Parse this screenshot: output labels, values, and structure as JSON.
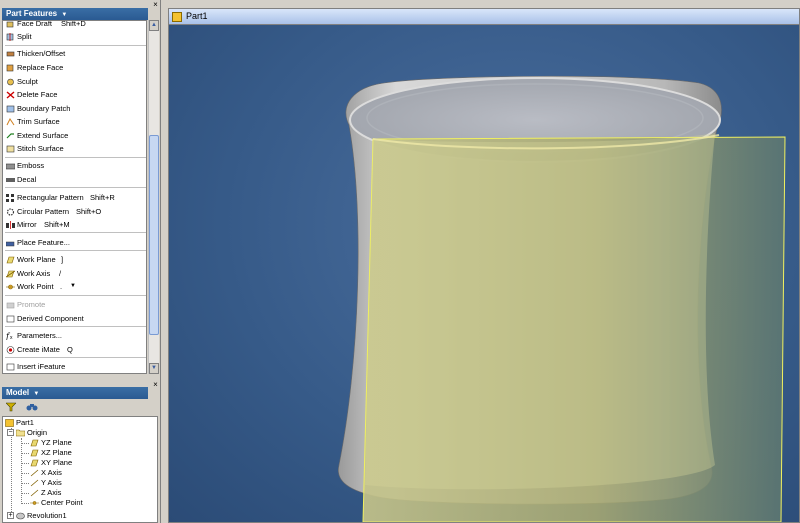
{
  "part_features": {
    "title": "Part Features",
    "items": [
      {
        "label": "Face Draft",
        "shortcut": "Shift+D"
      },
      {
        "label": "Split"
      },
      {
        "label": "Thicken/Offset"
      },
      {
        "label": "Replace Face"
      },
      {
        "label": "Sculpt"
      },
      {
        "label": "Delete Face"
      },
      {
        "label": "Boundary Patch"
      },
      {
        "label": "Trim Surface"
      },
      {
        "label": "Extend Surface"
      },
      {
        "label": "Stitch Surface"
      },
      {
        "label": "Emboss"
      },
      {
        "label": "Decal"
      },
      {
        "label": "Rectangular Pattern",
        "shortcut": "Shift+R"
      },
      {
        "label": "Circular Pattern",
        "shortcut": "Shift+O"
      },
      {
        "label": "Mirror",
        "shortcut": "Shift+M"
      },
      {
        "label": "Place Feature..."
      },
      {
        "label": "Work Plane",
        "shortcut": "]"
      },
      {
        "label": "Work Axis",
        "shortcut": "/"
      },
      {
        "label": "Work Point",
        "shortcut": "."
      },
      {
        "label": "Promote"
      },
      {
        "label": "Derived Component"
      },
      {
        "label": "Parameters..."
      },
      {
        "label": "Create iMate",
        "shortcut": "Q"
      },
      {
        "label": "Insert iFeature"
      }
    ]
  },
  "model": {
    "title": "Model",
    "tree": [
      {
        "label": "Part1"
      },
      {
        "label": "Origin"
      },
      {
        "label": "YZ Plane"
      },
      {
        "label": "XZ Plane"
      },
      {
        "label": "XY Plane"
      },
      {
        "label": "X Axis"
      },
      {
        "label": "Y Axis"
      },
      {
        "label": "Z Axis"
      },
      {
        "label": "Center Point"
      },
      {
        "label": "Revolution1"
      }
    ]
  },
  "viewport": {
    "title": "Part1"
  },
  "colors": {
    "header_blue": "#2f629b",
    "viewport_bg": "#3a5f8a",
    "work_plane": "#d9d98a",
    "part_gray": "#c8c8c8"
  },
  "help_label": "?",
  "close_label": "×"
}
